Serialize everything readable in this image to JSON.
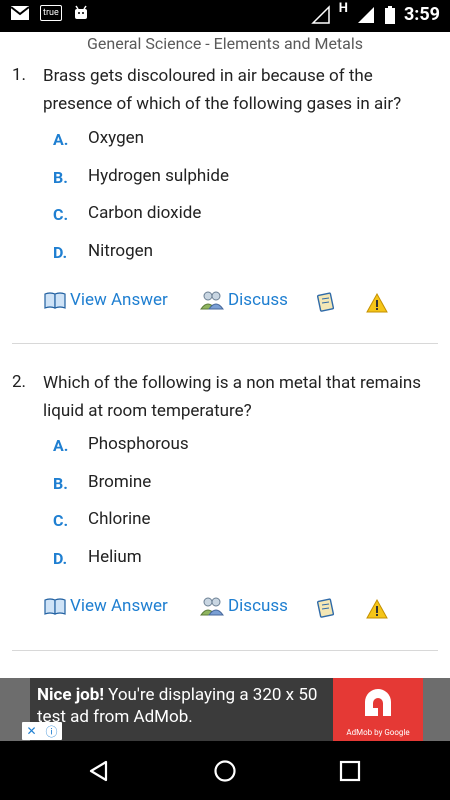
{
  "status_bar": {
    "carrier_badge": "true",
    "signal_indicator": "H",
    "time": "3:59"
  },
  "page": {
    "title": "General Science - Elements and Metals"
  },
  "questions": [
    {
      "number": "1.",
      "text": "Brass gets discoloured in air because of the presence of which of the following gases in air?",
      "options": [
        {
          "letter": "A.",
          "text": "Oxygen"
        },
        {
          "letter": "B.",
          "text": "Hydrogen sulphide"
        },
        {
          "letter": "C.",
          "text": "Carbon dioxide"
        },
        {
          "letter": "D.",
          "text": "Nitrogen"
        }
      ],
      "view_answer": "View Answer",
      "discuss": "Discuss"
    },
    {
      "number": "2.",
      "text": "Which of the following is a non metal that remains liquid at room temperature?",
      "options": [
        {
          "letter": "A.",
          "text": "Phosphorous"
        },
        {
          "letter": "B.",
          "text": "Bromine"
        },
        {
          "letter": "C.",
          "text": "Chlorine"
        },
        {
          "letter": "D.",
          "text": "Helium"
        }
      ],
      "view_answer": "View Answer",
      "discuss": "Discuss"
    }
  ],
  "ad": {
    "headline": "Nice job!",
    "body": " You're displaying a 320 x 50 test ad from AdMob.",
    "brand": "AdMob by Google"
  },
  "icons": {
    "status_left": [
      "gmail-icon",
      "true-badge-icon",
      "android-icon"
    ],
    "status_right": [
      "wifi-icon",
      "signal-icon",
      "battery-icon"
    ],
    "actions": [
      "book-icon",
      "people-icon",
      "notebook-icon",
      "warning-icon"
    ],
    "nav": [
      "back-icon",
      "home-icon",
      "recents-icon"
    ]
  },
  "colors": {
    "accent": "#1f7fd1",
    "ad_red": "#e53935",
    "warning": "#f5c518"
  }
}
